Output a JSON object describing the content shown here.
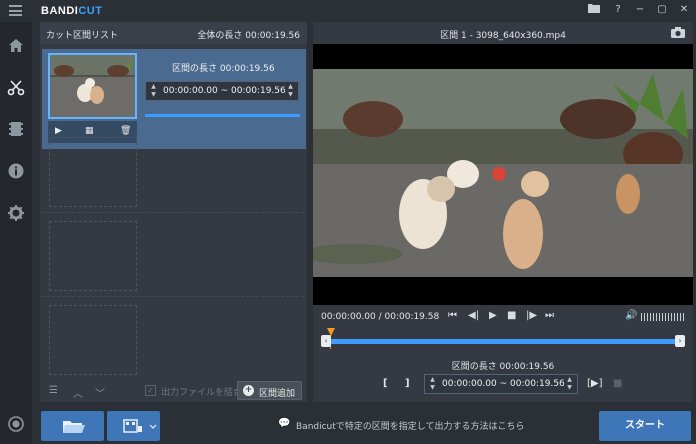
{
  "app": {
    "brand_main": "BANDI",
    "brand_accent": "CUT"
  },
  "window_controls": [
    "folder-icon",
    "help-icon",
    "minimize-icon",
    "maximize-icon",
    "close-icon"
  ],
  "sidebar": {
    "items": [
      {
        "icon": "menu-icon"
      },
      {
        "icon": "home-icon"
      },
      {
        "icon": "cut-icon",
        "active": true
      },
      {
        "icon": "film-icon"
      },
      {
        "icon": "info-icon"
      },
      {
        "icon": "settings-icon"
      },
      {
        "icon": "record-icon"
      }
    ]
  },
  "segments_panel": {
    "title": "カット区間リスト",
    "total_length": "全体の長さ 00:00:19.56",
    "segment": {
      "length_label": "区間の長さ 00:00:19.56",
      "range_text": "00:00:00.00 ~ 00:00:19.56",
      "progress": 1.0
    },
    "merge_label": "出力ファイルを結合",
    "merge_checked": true,
    "add_label": "区間追加"
  },
  "player": {
    "file_title": "区間 1 - 3098_640x360.mp4",
    "time_readout": "00:00:00.00 / 00:00:19.58",
    "segment_length_label": "区間の長さ 00:00:19.56",
    "range_text": "00:00:00.00 ~ 00:00:19.56",
    "bracket_start": "[",
    "bracket_end": "]"
  },
  "bottom": {
    "hint": "Bandicutで特定の区間を指定して出力する方法はこちら",
    "start_label": "スタート"
  },
  "colors": {
    "accent": "#3e76b8",
    "timeline": "#3b9bff",
    "playhead": "#f59a23",
    "selected_segment": "#4a6a8f"
  }
}
